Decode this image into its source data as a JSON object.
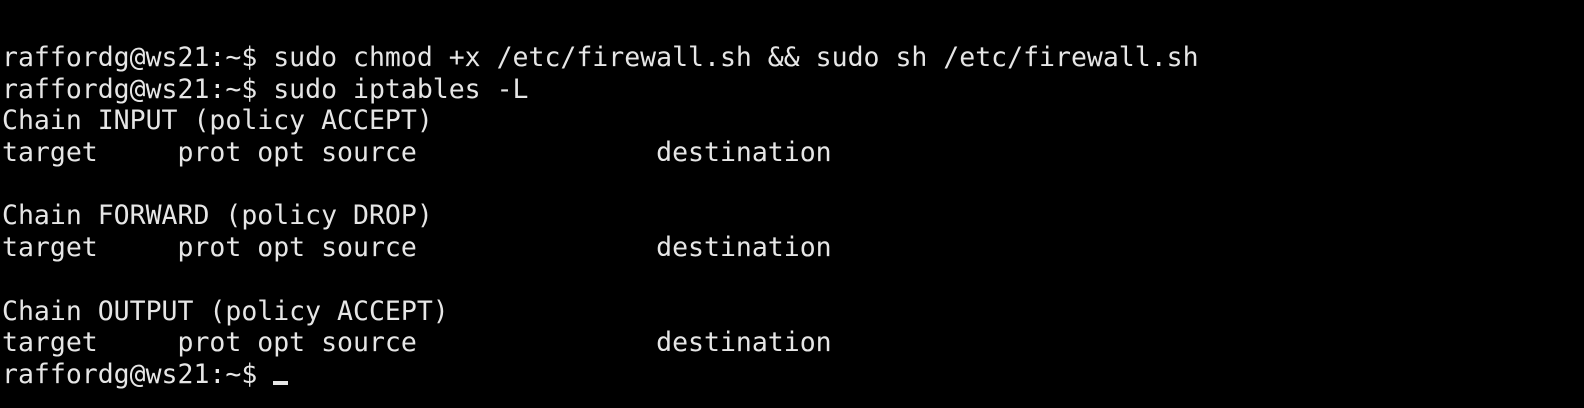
{
  "terminal": {
    "lines": [
      "raffordg@ws21:~$ sudo chmod +x /etc/firewall.sh && sudo sh /etc/firewall.sh",
      "raffordg@ws21:~$ sudo iptables -L",
      "Chain INPUT (policy ACCEPT)",
      "target     prot opt source               destination",
      "",
      "Chain FORWARD (policy DROP)",
      "target     prot opt source               destination",
      "",
      "Chain OUTPUT (policy ACCEPT)",
      "target     prot opt source               destination"
    ],
    "prompt": "raffordg@ws21:~$ "
  }
}
